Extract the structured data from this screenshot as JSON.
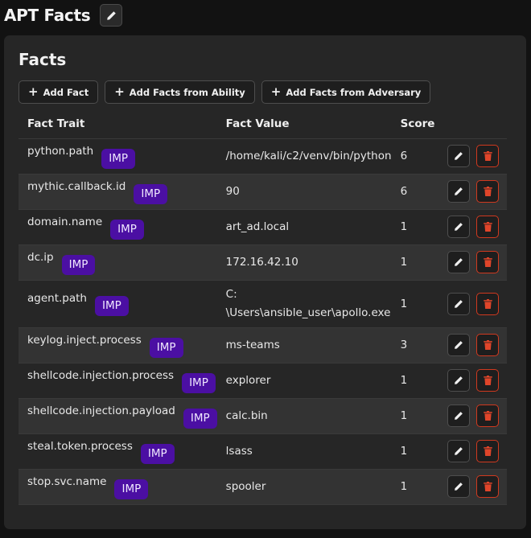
{
  "page": {
    "title": "APT Facts"
  },
  "panel": {
    "title": "Facts"
  },
  "toolbar": {
    "add_fact": "Add Fact",
    "add_from_ability": "Add Facts from Ability",
    "add_from_adversary": "Add Facts from Adversary"
  },
  "table": {
    "headers": {
      "trait": "Fact Trait",
      "value": "Fact Value",
      "score": "Score"
    },
    "badge_label": "IMP",
    "rows": [
      {
        "trait": "python.path",
        "value": "/home/kali/c2/venv/bin/python",
        "score": "6"
      },
      {
        "trait": "mythic.callback.id",
        "value": "90",
        "score": "6"
      },
      {
        "trait": "domain.name",
        "value": "art_ad.local",
        "score": "1"
      },
      {
        "trait": "dc.ip",
        "value": "172.16.42.10",
        "score": "1"
      },
      {
        "trait": "agent.path",
        "value": "C:\\Users\\ansible_user\\apollo.exe",
        "value_line1": "C:",
        "value_line2": "\\Users\\ansible_user\\apollo.exe",
        "score": "1"
      },
      {
        "trait": "keylog.inject.process",
        "value": "ms-teams",
        "score": "3"
      },
      {
        "trait": "shellcode.injection.process",
        "value": "explorer",
        "score": "1"
      },
      {
        "trait": "shellcode.injection.payload",
        "value": "calc.bin",
        "score": "1"
      },
      {
        "trait": "steal.token.process",
        "value": "lsass",
        "score": "1"
      },
      {
        "trait": "stop.svc.name",
        "value": "spooler",
        "score": "1"
      }
    ]
  },
  "colors": {
    "badge": "#4b0fa3",
    "delete_accent": "#d0391f",
    "panel_bg": "#262626",
    "page_bg": "#121212"
  },
  "icons": {
    "edit": "pencil-icon",
    "delete": "trash-icon",
    "add": "plus-icon"
  }
}
